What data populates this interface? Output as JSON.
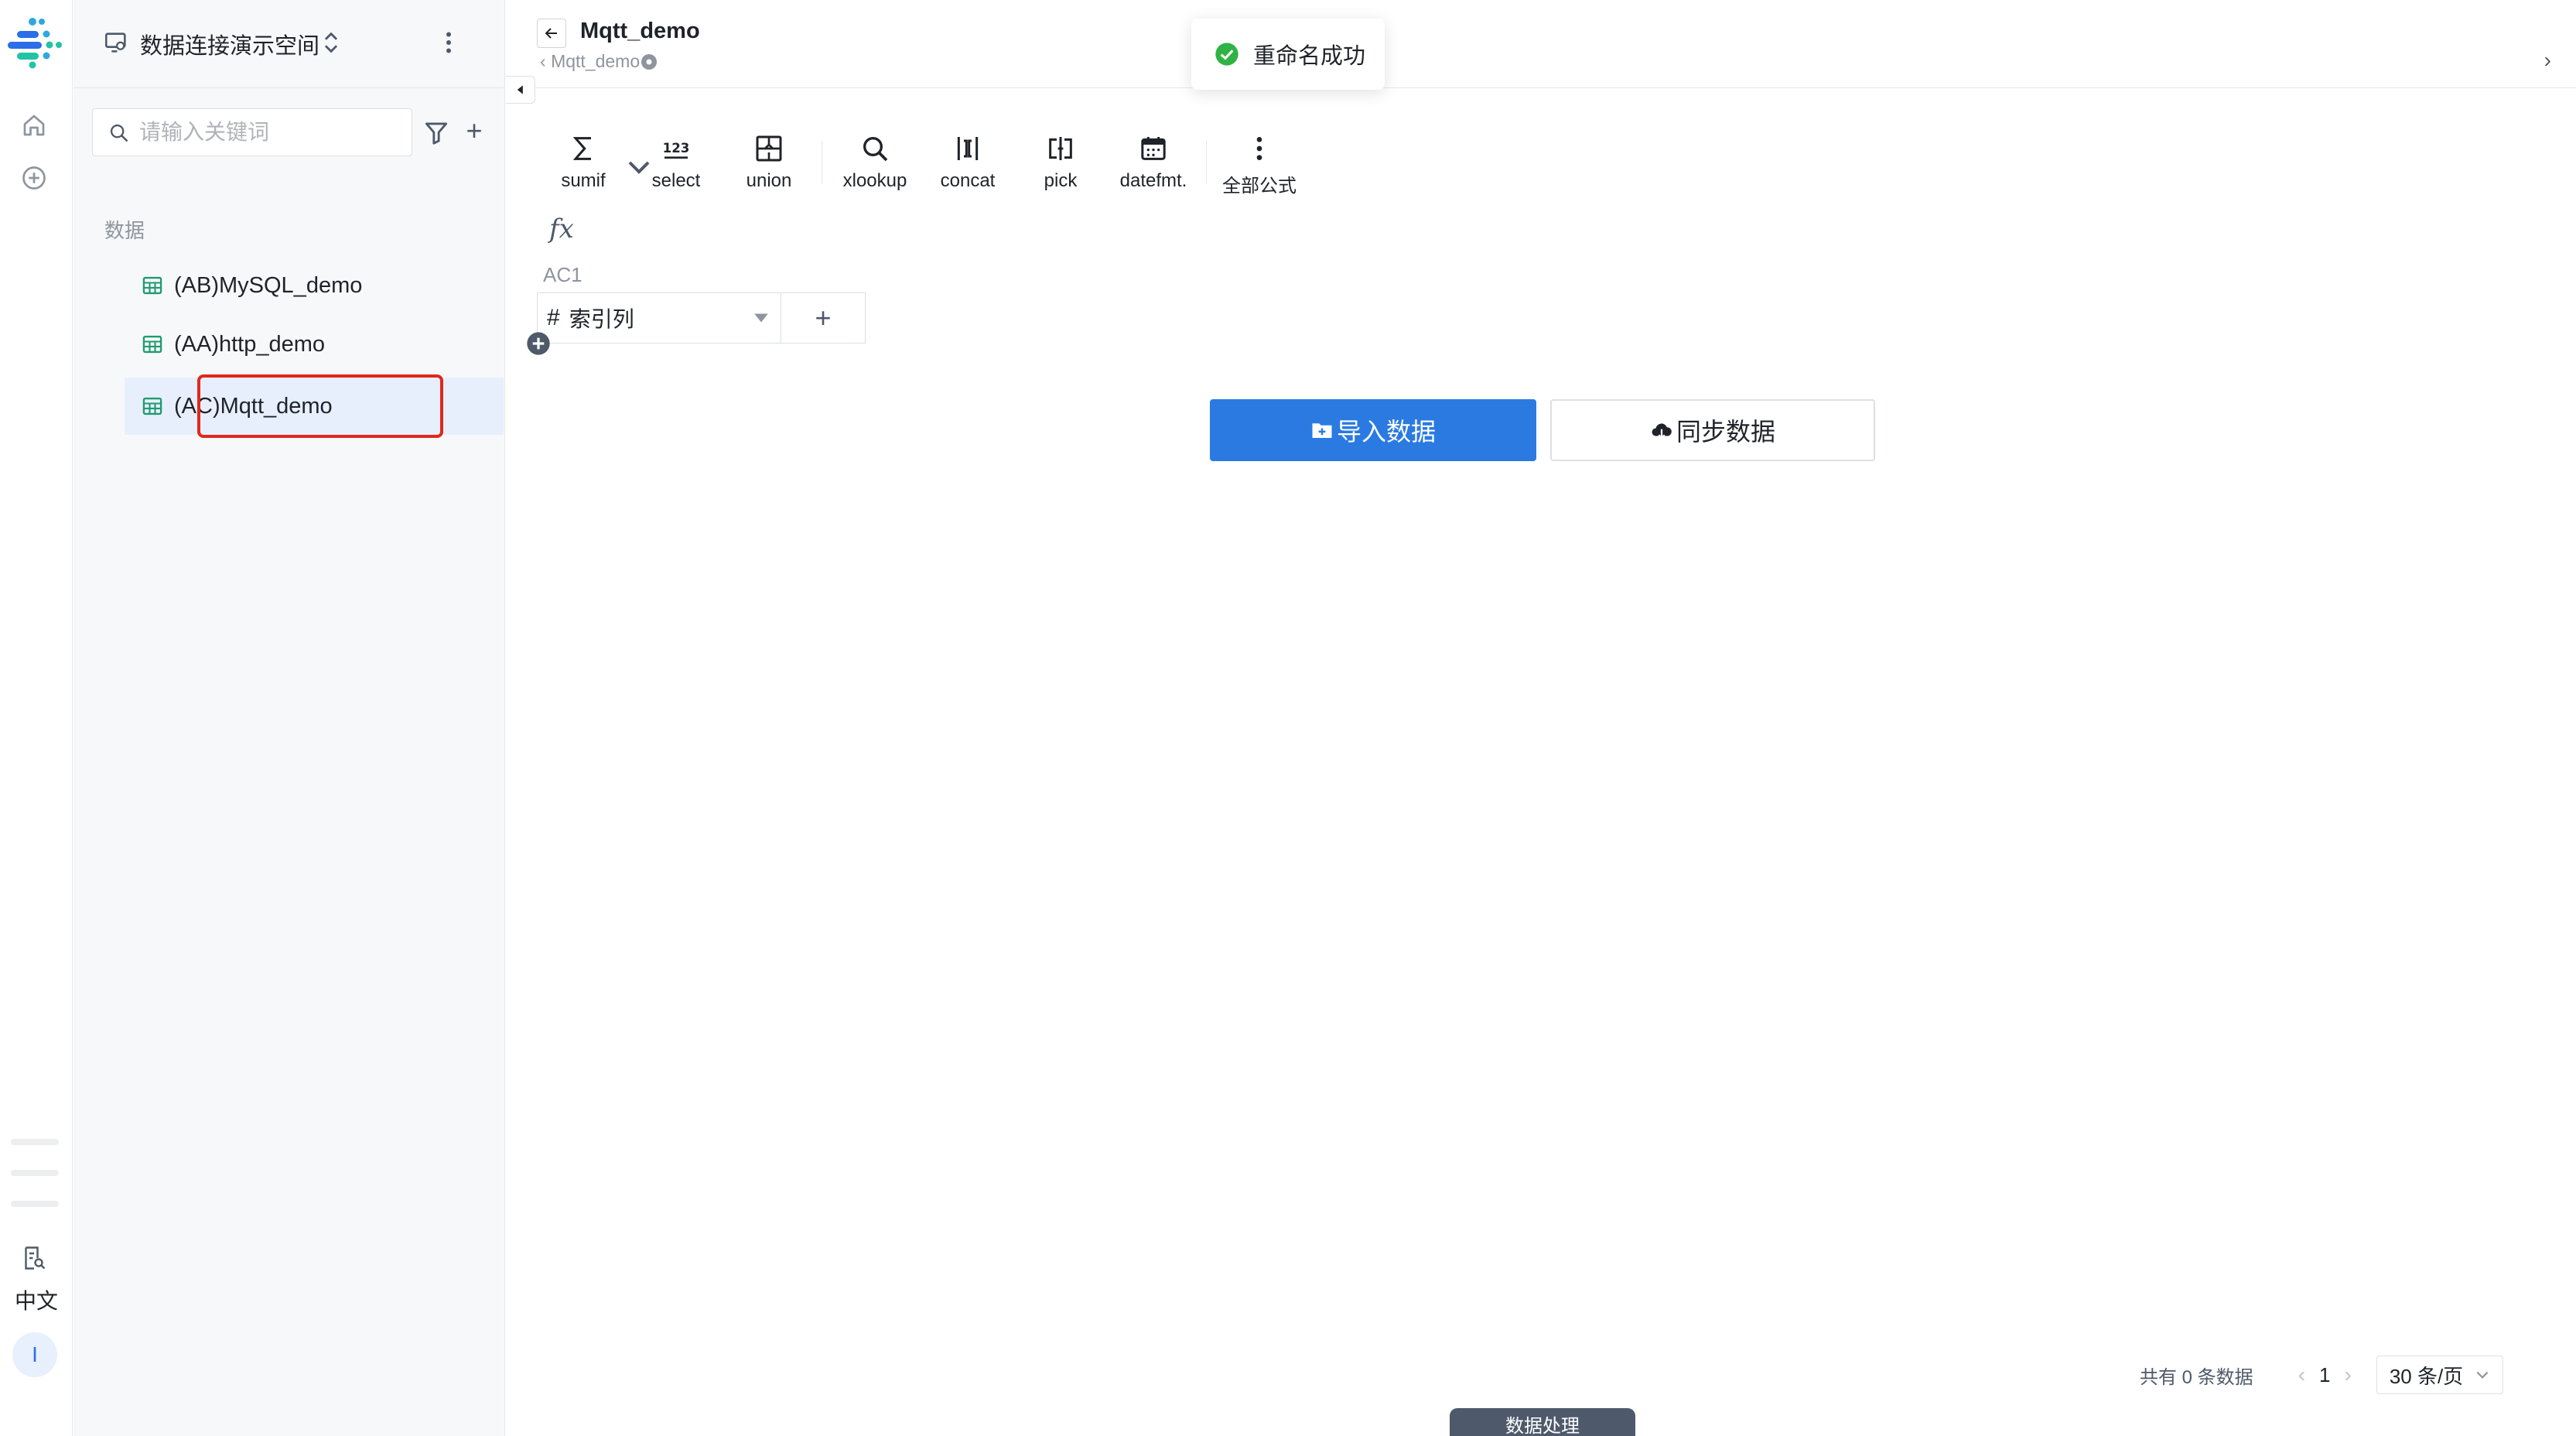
{
  "workspace": {
    "name": "数据连接演示空间"
  },
  "sidebar": {
    "search_placeholder": "请输入关键词",
    "section_label": "数据",
    "items": [
      {
        "label": "(AB)MySQL_demo"
      },
      {
        "label": "(AA)http_demo"
      },
      {
        "label": "(AC)Mqtt_demo"
      }
    ]
  },
  "rail": {
    "lang": "中文",
    "avatar": "I"
  },
  "header": {
    "title": "Mqtt_demo",
    "breadcrumb": "Mqtt_demo"
  },
  "toast": {
    "message": "重命名成功"
  },
  "toolbar": {
    "tools": [
      {
        "label": "sumif"
      },
      {
        "label": "select"
      },
      {
        "label": "union"
      },
      {
        "label": "xlookup"
      },
      {
        "label": "concat"
      },
      {
        "label": "pick"
      },
      {
        "label": "datefmt."
      },
      {
        "label": "全部公式"
      }
    ]
  },
  "formula": {
    "fx": "fx",
    "cell_ref": "AC1"
  },
  "table": {
    "column_type_symbol": "#",
    "column_name": "索引列",
    "add_column": "+"
  },
  "actions": {
    "import_label": "导入数据",
    "sync_label": "同步数据"
  },
  "pagination": {
    "total_text": "共有 0 条数据",
    "current_page": "1",
    "page_size": "30 条/页"
  },
  "bottom_tab": {
    "label": "数据处理"
  },
  "colors": {
    "primary": "#2a7ae2",
    "success": "#2fb344",
    "highlight": "#e0281b",
    "sheet_icon": "#1f9b6f"
  }
}
